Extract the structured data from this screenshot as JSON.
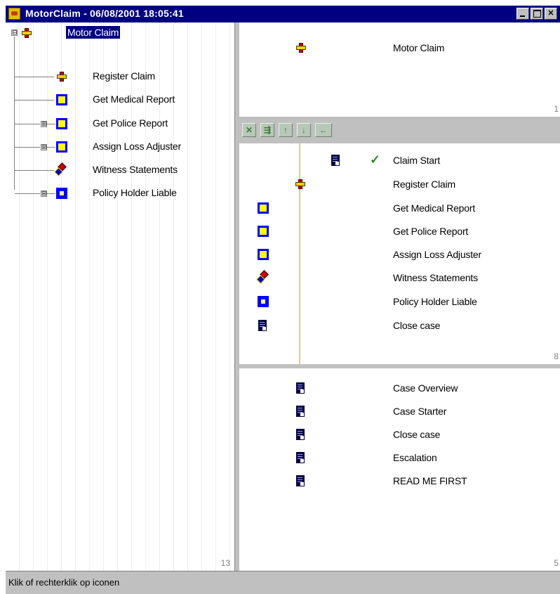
{
  "window": {
    "title": "MotorClaim  -  06/08/2001 18:05:41",
    "buttons": [
      "minimize",
      "maximize",
      "close"
    ],
    "close_glyph": "✕"
  },
  "tree": {
    "root": {
      "label": "Motor Claim",
      "icon": "process-icon",
      "expander": "⊟"
    },
    "items": [
      {
        "label": "Register Claim",
        "icon": "register-claim-icon",
        "expander": ""
      },
      {
        "label": "Get Medical Report",
        "icon": "task-icon",
        "expander": ""
      },
      {
        "label": "Get Police Report",
        "icon": "task-icon",
        "expander": "⊞"
      },
      {
        "label": "Assign Loss Adjuster",
        "icon": "task-icon",
        "expander": "⊞"
      },
      {
        "label": "Witness Statements",
        "icon": "multi-task-icon",
        "expander": ""
      },
      {
        "label": "Policy Holder Liable",
        "icon": "decision-icon",
        "expander": "⊞"
      }
    ],
    "count": "13"
  },
  "top_panel": {
    "label": "Motor Claim",
    "count": "1"
  },
  "toolbar": {
    "buttons": [
      {
        "name": "delete-tool",
        "glyph": "✕"
      },
      {
        "name": "hierarchy-tool",
        "glyph": "⇶"
      },
      {
        "name": "move-up-tool",
        "glyph": "↑"
      },
      {
        "name": "move-down-tool",
        "glyph": "↓"
      },
      {
        "name": "back-tool",
        "glyph": "←"
      }
    ]
  },
  "timeline": {
    "items": [
      {
        "label": "Claim Start",
        "icon": "document-icon",
        "checked": true
      },
      {
        "label": "Register Claim",
        "icon": "register-claim-icon"
      },
      {
        "label": "Get Medical Report",
        "icon": "task-icon"
      },
      {
        "label": "Get Police Report",
        "icon": "task-icon"
      },
      {
        "label": "Assign Loss Adjuster",
        "icon": "task-icon"
      },
      {
        "label": "Witness Statements",
        "icon": "multi-task-icon"
      },
      {
        "label": "Policy Holder Liable",
        "icon": "decision-icon"
      },
      {
        "label": "Close case",
        "icon": "document-icon"
      }
    ],
    "check_glyph": "✓",
    "count": "8"
  },
  "documents": {
    "items": [
      {
        "label": "Case Overview"
      },
      {
        "label": "Case Starter"
      },
      {
        "label": "Close case"
      },
      {
        "label": "Escalation"
      },
      {
        "label": "READ ME FIRST"
      }
    ],
    "count": "5"
  },
  "status": {
    "text": "Klik of rechterklik op iconen"
  },
  "colors": {
    "titlebar": "#000080",
    "selection": "#000080",
    "task_fill": "#ffff00",
    "task_border": "#0000ff",
    "check": "#2a8a2a",
    "timeline_line": "#e2c89a"
  }
}
